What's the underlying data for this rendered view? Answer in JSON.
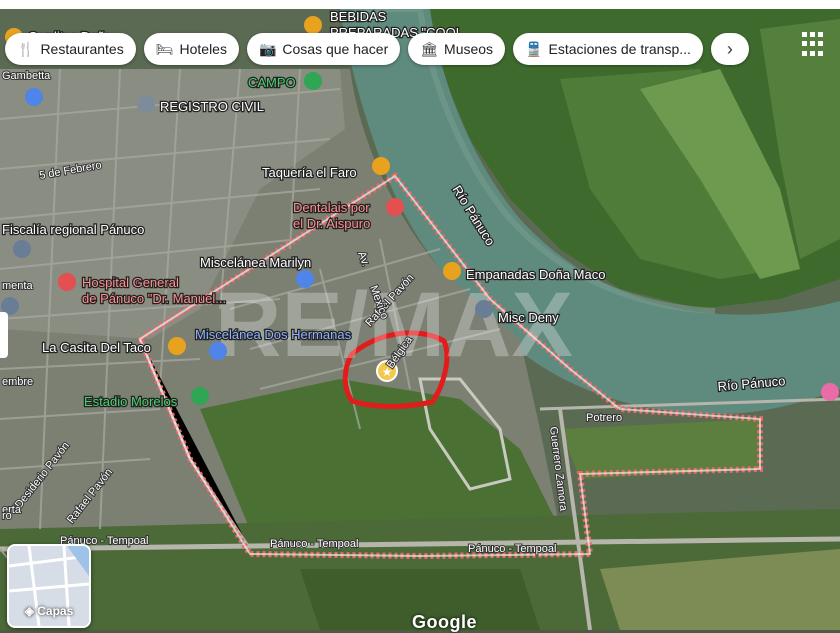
{
  "filters": [
    {
      "label": "Restaurantes",
      "icon": "fork-knife-icon"
    },
    {
      "label": "Hoteles",
      "icon": "bed-icon"
    },
    {
      "label": "Cosas que hacer",
      "icon": "camera-icon"
    },
    {
      "label": "Museos",
      "icon": "museum-icon"
    },
    {
      "label": "Estaciones de transp...",
      "icon": "train-icon"
    }
  ],
  "layers_label": "Capas",
  "attribution": "Google",
  "watermark": "RE/MAX",
  "places": [
    {
      "name": "BEBIDAS",
      "type": "food"
    },
    {
      "name": "PREPARADAS \"COOL...",
      "type": "label"
    },
    {
      "name": "Gorditas Doña...",
      "type": "food"
    },
    {
      "name": "CAMPO",
      "type": "park"
    },
    {
      "name": "REGISTRO CIVIL",
      "type": "gov"
    },
    {
      "name": "Taquería el Faro",
      "type": "food"
    },
    {
      "name": "Dentalais por",
      "type": "health"
    },
    {
      "name": "el Dr. Aispuro",
      "type": "label"
    },
    {
      "name": "Fiscalía regional Pánuco",
      "type": "gov"
    },
    {
      "name": "Miscelánea Marilyn",
      "type": "shop"
    },
    {
      "name": "Empanadas Doña Maco",
      "type": "food"
    },
    {
      "name": "Hospital General",
      "type": "health"
    },
    {
      "name": "de Pánuco \"Dr. Manuel...",
      "type": "label"
    },
    {
      "name": "Misc Deny",
      "type": "shop"
    },
    {
      "name": "La Casita Del Taco",
      "type": "food"
    },
    {
      "name": "Miscelánea Dos Hermanas",
      "type": "shop"
    },
    {
      "name": "Estadio Morelos",
      "type": "park"
    },
    {
      "name": "Río Pánuco",
      "type": "water"
    },
    {
      "name": "Río Pánuco",
      "type": "water"
    }
  ],
  "streets": [
    "5 de Febrero",
    "Rafael Pavón",
    "Bélgica",
    "Potrero",
    "Guerrero Zamora",
    "Desiderio Pavón",
    "Rafael Pavón",
    "Pánuco - Tempoal",
    "Pánuco - Tempoal",
    "Pánuco - Tempoal",
    "Gambetta",
    "Mexico",
    "Av.",
    "erta",
    "embre",
    "menta",
    "ro"
  ]
}
